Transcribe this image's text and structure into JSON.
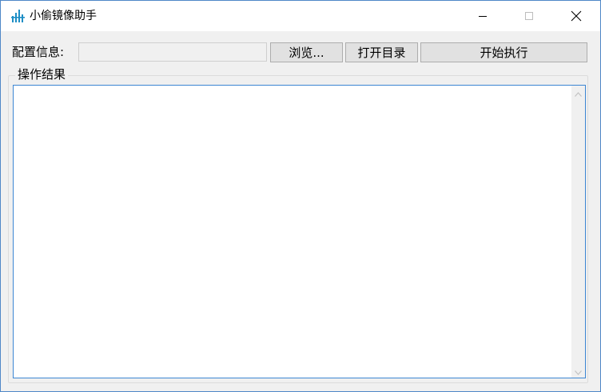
{
  "window": {
    "title": "小偷镜像助手",
    "icon": "app-logo-icon",
    "controls": {
      "minimize": "minimize-icon",
      "maximize": "maximize-icon",
      "close": "close-icon"
    }
  },
  "config": {
    "label": "配置信息:",
    "input_value": "",
    "browse_label": "浏览...",
    "open_dir_label": "打开目录",
    "execute_label": "开始执行"
  },
  "results": {
    "group_label": "操作结果",
    "text": ""
  },
  "colors": {
    "accent_border": "#3c86d3",
    "window_border": "#4f87c7",
    "icon_color": "#1d8ec5"
  }
}
